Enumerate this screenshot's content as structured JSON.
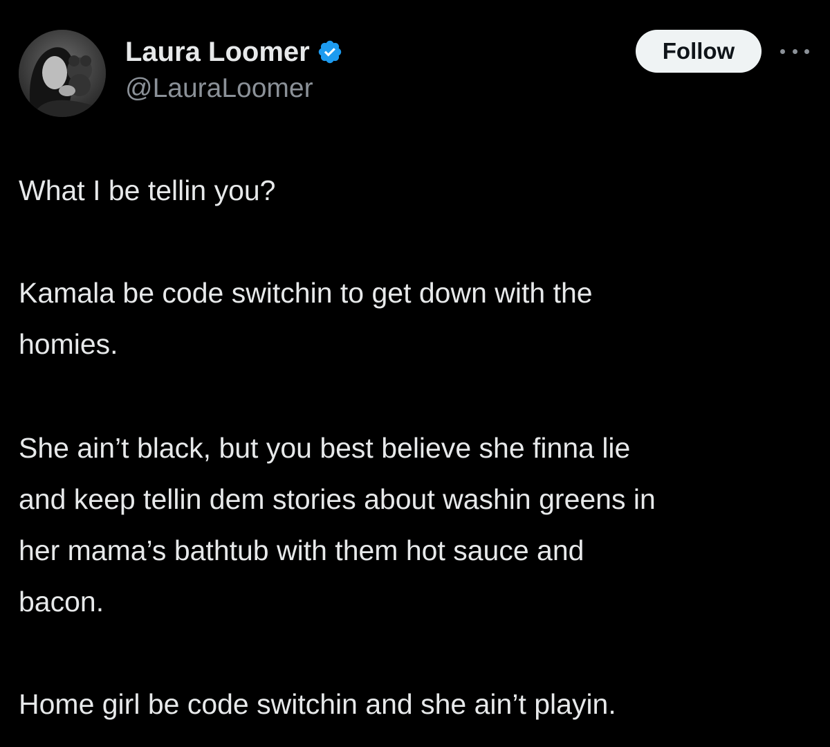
{
  "author": {
    "display_name": "Laura Loomer",
    "handle": "@LauraLoomer",
    "verified": true,
    "verified_color": "#1d9bf0"
  },
  "actions": {
    "follow_label": "Follow",
    "more_icon": "more-horizontal-icon"
  },
  "tweet": {
    "paragraphs": [
      {
        "lines": [
          "What I be tellin you?"
        ]
      },
      {
        "lines": [
          "Kamala be code switchin to get down with the",
          "homies."
        ]
      },
      {
        "lines": [
          "She ain’t black, but you best believe she finna lie",
          "and keep tellin dem stories about washin greens in",
          "her mama’s bathtub with them hot sauce and",
          "bacon."
        ]
      },
      {
        "lines": [
          "Home girl be code switchin and she ain’t playin."
        ]
      }
    ]
  },
  "colors": {
    "background": "#000000",
    "text": "#e7e9ea",
    "secondary_text": "#8b9198",
    "button_bg": "#eff3f4"
  }
}
